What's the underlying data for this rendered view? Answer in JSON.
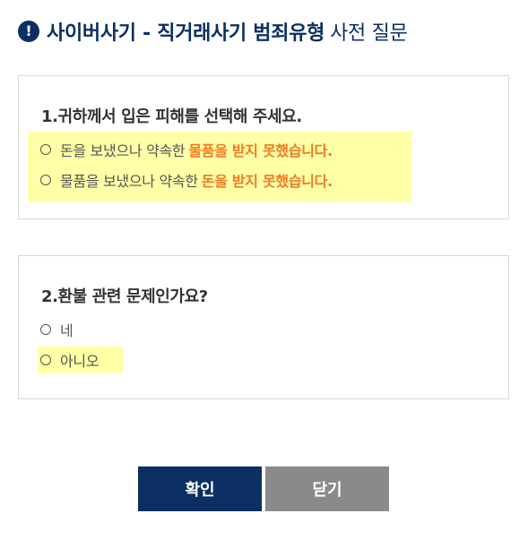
{
  "header": {
    "icon": "info-icon",
    "icon_text": "!",
    "title_main": "사이버사기 - 직거래사기 범죄유형",
    "title_suffix": "사전 질문"
  },
  "questions": [
    {
      "label": "1.귀하께서 입은 피해를 선택해 주세요.",
      "options": [
        {
          "plain": "돈을 보냈으나 약속한",
          "emphasis": "물품을 받지 못했습니다."
        },
        {
          "plain": "물품을 보냈으나 약속한",
          "emphasis": "돈을 받지 못했습니다."
        }
      ]
    },
    {
      "label": "2.환불 관련 문제인가요?",
      "options": [
        {
          "plain": "네"
        },
        {
          "plain": "아니오"
        }
      ]
    }
  ],
  "buttons": {
    "confirm": "확인",
    "close": "닫기"
  },
  "colors": {
    "navy": "#0b2f62",
    "gray_button": "#8a8a8a",
    "highlight": "#ffffa8",
    "emphasis": "#f07b22"
  }
}
